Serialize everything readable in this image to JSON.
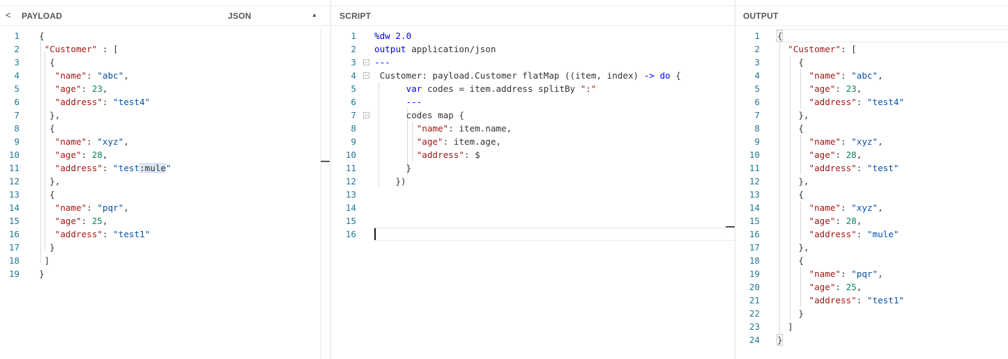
{
  "payload": {
    "back_label": "<",
    "title": "PAYLOAD",
    "format_label": "JSON",
    "caret": "▲",
    "lines": [
      [
        [
          "p",
          "{"
        ]
      ],
      [
        [
          "p",
          " "
        ],
        [
          "k",
          "\"Customer\""
        ],
        [
          "p",
          " : ["
        ]
      ],
      [
        [
          "p",
          "  {"
        ]
      ],
      [
        [
          "p",
          "   "
        ],
        [
          "k",
          "\"name\""
        ],
        [
          "p",
          ": "
        ],
        [
          "s",
          "\"abc\""
        ],
        [
          "p",
          ","
        ]
      ],
      [
        [
          "p",
          "   "
        ],
        [
          "k",
          "\"age\""
        ],
        [
          "p",
          ": "
        ],
        [
          "n",
          "23"
        ],
        [
          "p",
          ","
        ]
      ],
      [
        [
          "p",
          "   "
        ],
        [
          "k",
          "\"address\""
        ],
        [
          "p",
          ": "
        ],
        [
          "s",
          "\"test4\""
        ]
      ],
      [
        [
          "p",
          "  },"
        ]
      ],
      [
        [
          "p",
          "  {"
        ]
      ],
      [
        [
          "p",
          "   "
        ],
        [
          "k",
          "\"name\""
        ],
        [
          "p",
          ": "
        ],
        [
          "s",
          "\"xyz\""
        ],
        [
          "p",
          ","
        ]
      ],
      [
        [
          "p",
          "   "
        ],
        [
          "k",
          "\"age\""
        ],
        [
          "p",
          ": "
        ],
        [
          "n",
          "28"
        ],
        [
          "p",
          ","
        ]
      ],
      [
        [
          "p",
          "   "
        ],
        [
          "k",
          "\"address\""
        ],
        [
          "p",
          ": "
        ],
        [
          "s",
          "\"test"
        ],
        [
          "sel",
          ":mule"
        ],
        [
          "s",
          "\""
        ]
      ],
      [
        [
          "p",
          "  },"
        ]
      ],
      [
        [
          "p",
          "  {"
        ]
      ],
      [
        [
          "p",
          "   "
        ],
        [
          "k",
          "\"name\""
        ],
        [
          "p",
          ": "
        ],
        [
          "s",
          "\"pqr\""
        ],
        [
          "p",
          ","
        ]
      ],
      [
        [
          "p",
          "   "
        ],
        [
          "k",
          "\"age\""
        ],
        [
          "p",
          ": "
        ],
        [
          "n",
          "25"
        ],
        [
          "p",
          ","
        ]
      ],
      [
        [
          "p",
          "   "
        ],
        [
          "k",
          "\"address\""
        ],
        [
          "p",
          ": "
        ],
        [
          "s",
          "\"test1\""
        ]
      ],
      [
        [
          "p",
          "  }"
        ]
      ],
      [
        [
          "p",
          " ]"
        ]
      ],
      [
        [
          "p",
          "}"
        ]
      ]
    ]
  },
  "script": {
    "title": "SCRIPT",
    "lines": [
      [
        [
          "dw",
          "%dw 2.0"
        ]
      ],
      [
        [
          "dw",
          "output"
        ],
        [
          "p",
          " application/json"
        ]
      ],
      [
        [
          "dw",
          "---"
        ]
      ],
      [
        [
          "p",
          " Customer: payload.Customer flatMap ((item, index) "
        ],
        [
          "dw",
          "->"
        ],
        [
          "p",
          " "
        ],
        [
          "dw",
          "do"
        ],
        [
          "p",
          " {"
        ]
      ],
      [
        [
          "p",
          "      "
        ],
        [
          "dw",
          "var"
        ],
        [
          "p",
          " codes = item.address splitBy "
        ],
        [
          "k",
          "\":\""
        ]
      ],
      [
        [
          "p",
          "      "
        ],
        [
          "dw",
          "---"
        ]
      ],
      [
        [
          "p",
          "      codes map {"
        ]
      ],
      [
        [
          "p",
          "        "
        ],
        [
          "k",
          "\"name\""
        ],
        [
          "p",
          ": item.name,"
        ]
      ],
      [
        [
          "p",
          "        "
        ],
        [
          "k",
          "\"age\""
        ],
        [
          "p",
          ": item.age,"
        ]
      ],
      [
        [
          "p",
          "        "
        ],
        [
          "k",
          "\"address\""
        ],
        [
          "p",
          ": $"
        ]
      ],
      [
        [
          "p",
          "      }"
        ]
      ],
      [
        [
          "p",
          "    })"
        ]
      ],
      [],
      [],
      [],
      []
    ]
  },
  "output": {
    "title": "OUTPUT",
    "lines": [
      [
        [
          "p",
          "{"
        ]
      ],
      [
        [
          "p",
          "  "
        ],
        [
          "k",
          "\"Customer\""
        ],
        [
          "p",
          ": ["
        ]
      ],
      [
        [
          "p",
          "    {"
        ]
      ],
      [
        [
          "p",
          "      "
        ],
        [
          "k",
          "\"name\""
        ],
        [
          "p",
          ": "
        ],
        [
          "s",
          "\"abc\""
        ],
        [
          "p",
          ","
        ]
      ],
      [
        [
          "p",
          "      "
        ],
        [
          "k",
          "\"age\""
        ],
        [
          "p",
          ": "
        ],
        [
          "n",
          "23"
        ],
        [
          "p",
          ","
        ]
      ],
      [
        [
          "p",
          "      "
        ],
        [
          "k",
          "\"address\""
        ],
        [
          "p",
          ": "
        ],
        [
          "s",
          "\"test4\""
        ]
      ],
      [
        [
          "p",
          "    },"
        ]
      ],
      [
        [
          "p",
          "    {"
        ]
      ],
      [
        [
          "p",
          "      "
        ],
        [
          "k",
          "\"name\""
        ],
        [
          "p",
          ": "
        ],
        [
          "s",
          "\"xyz\""
        ],
        [
          "p",
          ","
        ]
      ],
      [
        [
          "p",
          "      "
        ],
        [
          "k",
          "\"age\""
        ],
        [
          "p",
          ": "
        ],
        [
          "n",
          "28"
        ],
        [
          "p",
          ","
        ]
      ],
      [
        [
          "p",
          "      "
        ],
        [
          "k",
          "\"address\""
        ],
        [
          "p",
          ": "
        ],
        [
          "s",
          "\"test\""
        ]
      ],
      [
        [
          "p",
          "    },"
        ]
      ],
      [
        [
          "p",
          "    {"
        ]
      ],
      [
        [
          "p",
          "      "
        ],
        [
          "k",
          "\"name\""
        ],
        [
          "p",
          ": "
        ],
        [
          "s",
          "\"xyz\""
        ],
        [
          "p",
          ","
        ]
      ],
      [
        [
          "p",
          "      "
        ],
        [
          "k",
          "\"age\""
        ],
        [
          "p",
          ": "
        ],
        [
          "n",
          "28"
        ],
        [
          "p",
          ","
        ]
      ],
      [
        [
          "p",
          "      "
        ],
        [
          "k",
          "\"address\""
        ],
        [
          "p",
          ": "
        ],
        [
          "s",
          "\"mule\""
        ]
      ],
      [
        [
          "p",
          "    },"
        ]
      ],
      [
        [
          "p",
          "    {"
        ]
      ],
      [
        [
          "p",
          "      "
        ],
        [
          "k",
          "\"name\""
        ],
        [
          "p",
          ": "
        ],
        [
          "s",
          "\"pqr\""
        ],
        [
          "p",
          ","
        ]
      ],
      [
        [
          "p",
          "      "
        ],
        [
          "k",
          "\"age\""
        ],
        [
          "p",
          ": "
        ],
        [
          "n",
          "25"
        ],
        [
          "p",
          ","
        ]
      ],
      [
        [
          "p",
          "      "
        ],
        [
          "k",
          "\"address\""
        ],
        [
          "p",
          ": "
        ],
        [
          "s",
          "\"test1\""
        ]
      ],
      [
        [
          "p",
          "    }"
        ]
      ],
      [
        [
          "p",
          "  ]"
        ]
      ],
      [
        [
          "p",
          "}"
        ]
      ]
    ]
  },
  "colors": {
    "key": "#a31515",
    "string": "#0451a5",
    "number": "#098658",
    "keyword": "#0000ff",
    "line_number": "#237893"
  }
}
